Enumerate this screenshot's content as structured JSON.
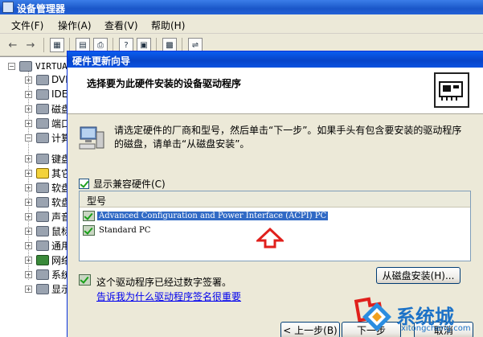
{
  "device_manager": {
    "title": "设备管理器",
    "menu": [
      "文件(F)",
      "操作(A)",
      "查看(V)",
      "帮助(H)"
    ],
    "tree": {
      "root": "VIRTUAL",
      "items": [
        "DVD",
        "IDE",
        "磁盘",
        "端口",
        "计算",
        "键盘",
        "其它",
        "软盘",
        "软盘",
        "声音",
        "鼠标",
        "通用",
        "网络",
        "系统",
        "显示"
      ]
    }
  },
  "wizard": {
    "title": "硬件更新向导",
    "heading": "选择要为此硬件安装的设备驱动程序",
    "instruction": "请选定硬件的厂商和型号，然后单击“下一步”。如果手头有包含要安装的驱动程序的磁盘，请单击“从磁盘安装”。",
    "show_compatible_label": "显示兼容硬件(C)",
    "show_compatible_checked": true,
    "list_header": "型号",
    "models": [
      {
        "name": "Advanced Configuration and Power Interface (ACPI) PC",
        "selected": true
      },
      {
        "name": "Standard PC",
        "selected": false
      }
    ],
    "signed_text": "这个驱动程序已经过数字签署。",
    "signing_link": "告诉我为什么驱动程序签名很重要",
    "have_disk_button": "从磁盘安装(H)...",
    "back_button": "< 上一步(B)",
    "next_button": "下一步",
    "cancel_button": "取消"
  },
  "watermark": {
    "text": "系统城",
    "url": "xitongcheng.com"
  },
  "colors": {
    "title_blue": "#0844c8",
    "selection_blue": "#316ac5",
    "arrow_red": "#e0201c",
    "link_blue": "#0000ee"
  }
}
